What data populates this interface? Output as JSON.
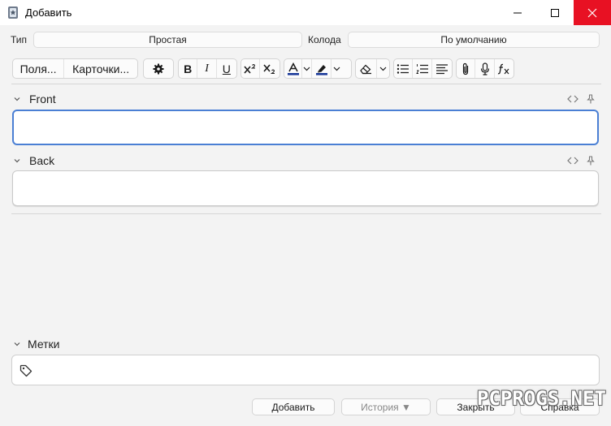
{
  "window": {
    "title": "Добавить",
    "close_color": "#e81123"
  },
  "topbar": {
    "type_label": "Тип",
    "type_value": "Простая",
    "deck_label": "Колода",
    "deck_value": "По умолчанию"
  },
  "toolbar": {
    "fields_label": "Поля...",
    "cards_label": "Карточки...",
    "bold": "B",
    "italic": "I",
    "underline": "U",
    "text_color": "#1a3a9a",
    "highlight_color": "#1a3a9a"
  },
  "fields": [
    {
      "name": "Front"
    },
    {
      "name": "Back"
    }
  ],
  "tags": {
    "label": "Метки"
  },
  "buttons": {
    "add": "Добавить",
    "history": "История ▼",
    "close": "Закрыть",
    "help": "Справка"
  },
  "watermark": "PCPROGS.NET",
  "colors": {
    "focus_border": "#4a7fd4"
  }
}
